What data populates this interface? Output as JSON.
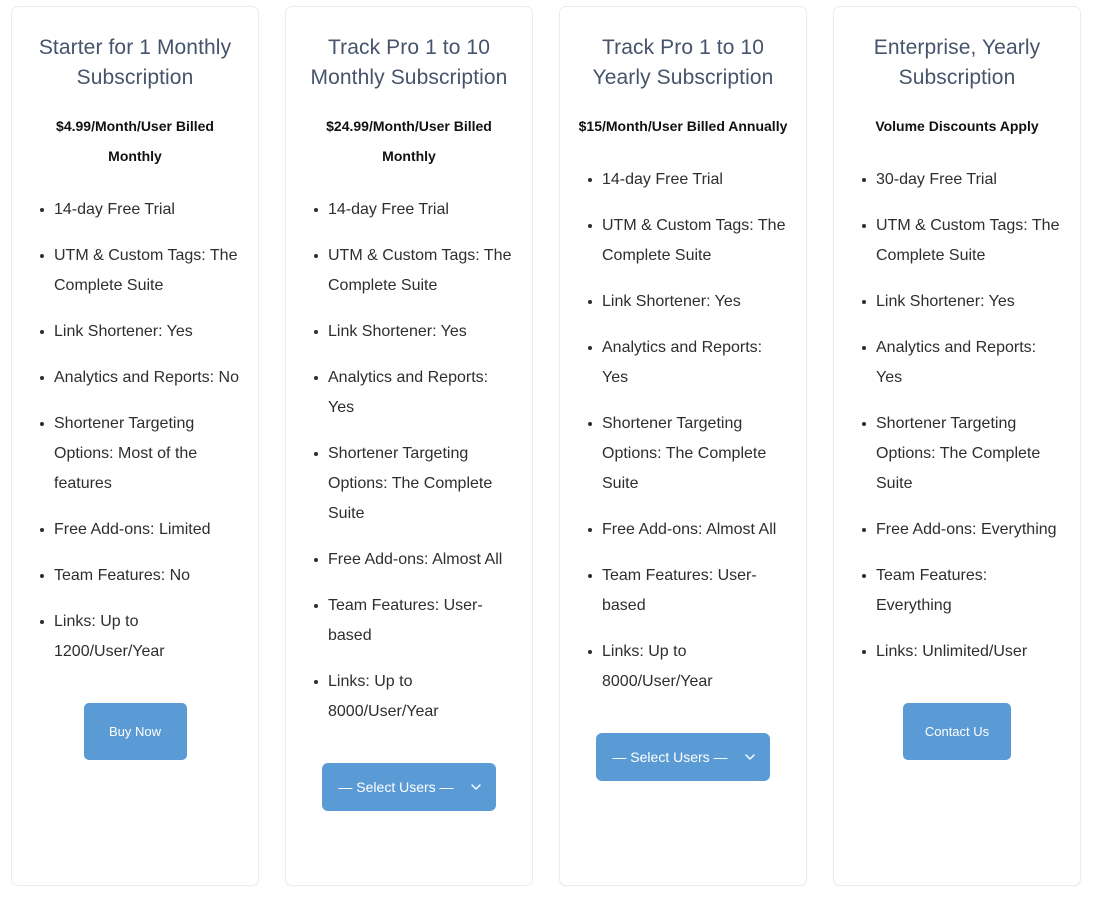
{
  "theme": {
    "accent_blue": "#5b9bd5",
    "title_color": "#46546b",
    "body_text_color": "#2e2e2e",
    "card_border_color": "#ebebeb",
    "page_background": "#ffffff"
  },
  "plans": [
    {
      "title": "Starter for 1 Monthly Subscription",
      "price": "$4.99/Month/User Billed Monthly",
      "features": [
        "14-day Free Trial",
        "UTM & Custom Tags: The Complete Suite",
        "Link Shortener: Yes",
        "Analytics and Reports: No",
        "Shortener Targeting Options: Most of the features",
        "Free Add-ons: Limited",
        "Team Features: No",
        "Links: Up to 1200/User/Year"
      ],
      "action": {
        "type": "button",
        "label": "Buy Now"
      }
    },
    {
      "title": "Track Pro 1 to 10 Monthly Subscription",
      "price": "$24.99/Month/User Billed Monthly",
      "features": [
        "14-day Free Trial",
        "UTM & Custom Tags: The Complete Suite",
        "Link Shortener: Yes",
        "Analytics and Reports: Yes",
        "Shortener Targeting Options: The Complete Suite",
        "Free Add-ons: Almost All",
        "Team Features: User-based",
        "Links: Up to 8000/User/Year"
      ],
      "action": {
        "type": "select",
        "label": "— Select Users —",
        "icon": "chevron-down-icon"
      }
    },
    {
      "title": "Track Pro 1 to 10 Yearly Subscription",
      "price": "$15/Month/User Billed Annually",
      "features": [
        "14-day Free Trial",
        "UTM & Custom Tags: The Complete Suite",
        "Link Shortener: Yes",
        "Analytics and Reports: Yes",
        "Shortener Targeting Options: The Complete Suite",
        "Free Add-ons: Almost All",
        "Team Features: User-based",
        "Links: Up to 8000/User/Year"
      ],
      "action": {
        "type": "select",
        "label": "— Select Users —",
        "icon": "chevron-down-icon"
      }
    },
    {
      "title": "Enterprise, Yearly Subscription",
      "price": "Volume Discounts Apply",
      "features": [
        "30-day Free Trial",
        "UTM & Custom Tags: The Complete Suite",
        "Link Shortener: Yes",
        "Analytics and Reports: Yes",
        "Shortener Targeting Options: The Complete Suite",
        "Free Add-ons: Everything",
        "Team Features: Everything",
        "Links: Unlimited/User"
      ],
      "action": {
        "type": "button",
        "label": "Contact Us"
      }
    }
  ]
}
